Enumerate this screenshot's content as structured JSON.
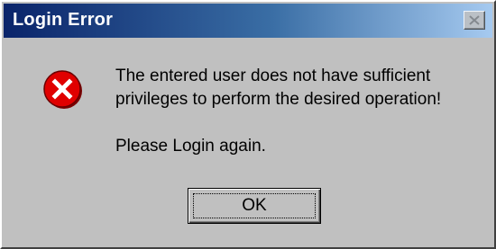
{
  "window": {
    "title": "Login Error"
  },
  "titlebar": {
    "close_icon": "close-icon"
  },
  "message": {
    "icon": "error-icon",
    "line1": "The entered user does not have sufficient",
    "line2": "privileges to perform the desired operation!",
    "secondary": "Please Login again."
  },
  "buttons": {
    "ok_label": "OK"
  },
  "colors": {
    "dialog_bg": "#c0c0c0",
    "title_start": "#0a246a",
    "title_end": "#a6caf0",
    "error_red": "#e00000"
  }
}
